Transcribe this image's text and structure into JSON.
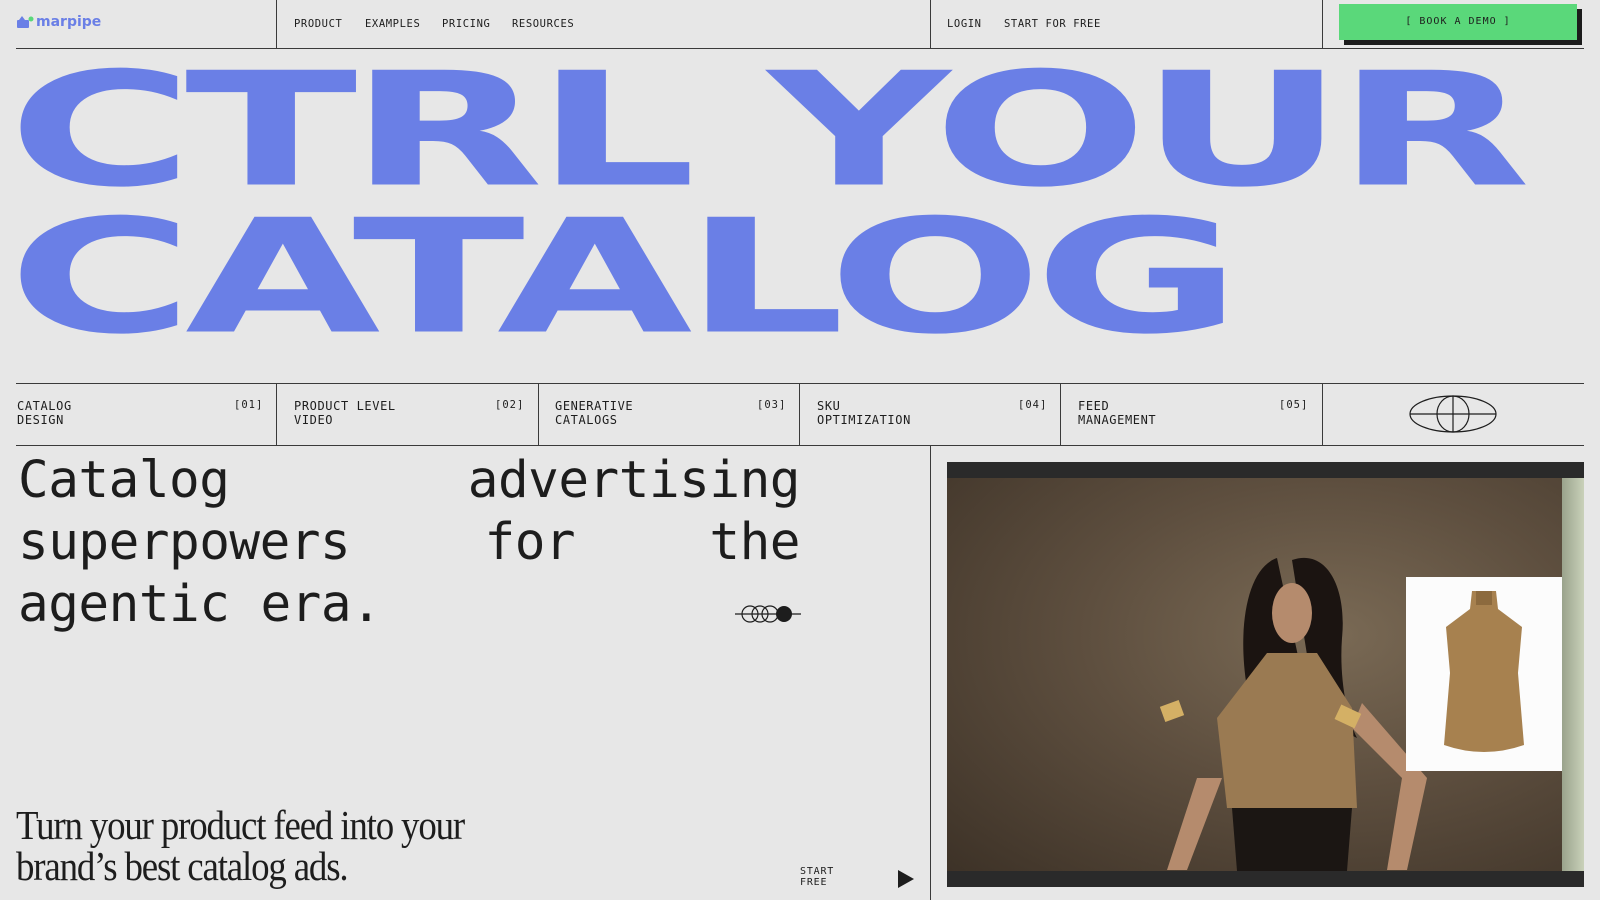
{
  "brand": {
    "name": "marpipe",
    "color": "#6a7fe6"
  },
  "nav": {
    "links": [
      "PRODUCT",
      "EXAMPLES",
      "PRICING",
      "RESOURCES"
    ],
    "login": "LOGIN",
    "start": "START FOR FREE",
    "demo": "[ BOOK A DEMO ]"
  },
  "hero": {
    "line1": "CTRL YOUR",
    "line2": "CATALOG"
  },
  "features": [
    {
      "line1": "CATALOG",
      "line2": "DESIGN",
      "num": "[01]"
    },
    {
      "line1": "PRODUCT LEVEL",
      "line2": "VIDEO",
      "num": "[02]"
    },
    {
      "line1": "GENERATIVE",
      "line2": "CATALOGS",
      "num": "[03]"
    },
    {
      "line1": "SKU",
      "line2": "OPTIMIZATION",
      "num": "[04]"
    },
    {
      "line1": "FEED",
      "line2": "MANAGEMENT",
      "num": "[05]"
    }
  ],
  "tagline": {
    "row1": [
      "Catalog",
      "advertising"
    ],
    "row2": [
      "superpowers",
      "for",
      "the"
    ],
    "row3": [
      "agentic",
      "era."
    ]
  },
  "subline": {
    "line1": "Turn your product feed into your",
    "line2": "brand’s best catalog ads."
  },
  "cta": {
    "line1": "START",
    "line2": "FREE"
  },
  "colors": {
    "background": "#e7e7e7",
    "headline": "#6a7fe6",
    "demo_button": "#5ad87a",
    "text": "#1d1d1d"
  },
  "icons": [
    "logo-icon",
    "globe-icon",
    "circles-icon",
    "play-arrow-icon"
  ]
}
